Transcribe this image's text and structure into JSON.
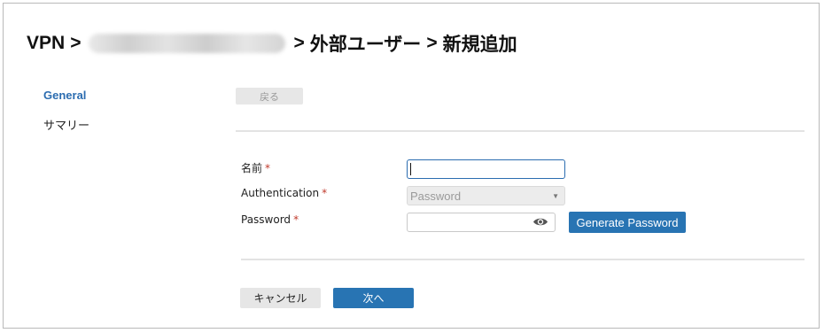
{
  "breadcrumb": {
    "root": "VPN",
    "separator": ">",
    "redacted_segment": "",
    "section": "外部ユーザー",
    "current": "新規追加"
  },
  "sidebar": {
    "items": [
      {
        "label": "General",
        "active": true
      },
      {
        "label": "サマリー",
        "active": false
      }
    ]
  },
  "toolbar": {
    "back_label": "戻る"
  },
  "form": {
    "required_marker": "*",
    "name": {
      "label": "名前",
      "value": ""
    },
    "authentication": {
      "label": "Authentication",
      "selected": "Password"
    },
    "password": {
      "label": "Password",
      "value": ""
    },
    "generate_password_label": "Generate Password"
  },
  "actions": {
    "cancel_label": "キャンセル",
    "next_label": "次へ"
  },
  "colors": {
    "accent": "#2874b3",
    "active_link": "#2b6cb0",
    "required": "#c0392b"
  }
}
